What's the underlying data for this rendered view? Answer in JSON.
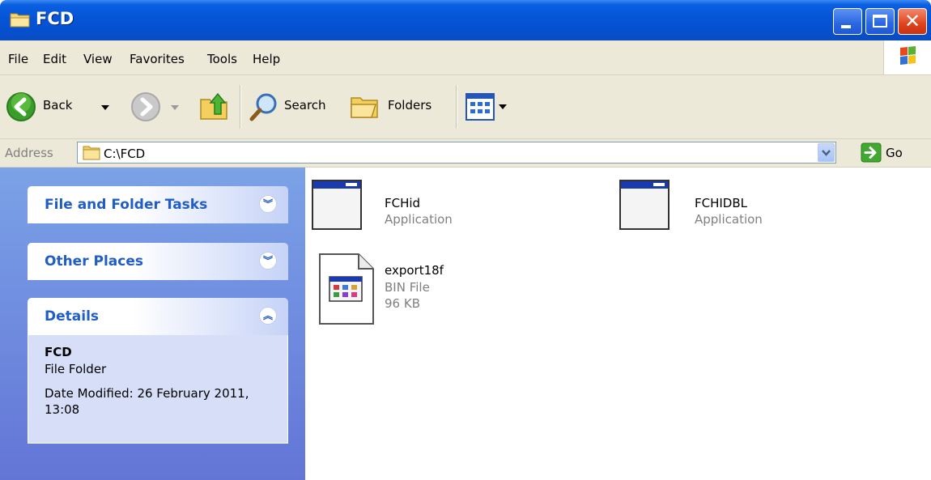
{
  "window": {
    "title": "FCD"
  },
  "menu": [
    "File",
    "Edit",
    "View",
    "Favorites",
    "Tools",
    "Help"
  ],
  "toolbar": {
    "back_label": "Back",
    "search_label": "Search",
    "folders_label": "Folders"
  },
  "address": {
    "label": "Address",
    "path": "C:\\FCD",
    "go_label": "Go"
  },
  "tasks": {
    "file_folder_tasks": "File and Folder Tasks",
    "other_places": "Other Places",
    "details": "Details"
  },
  "details": {
    "name": "FCD",
    "type": "File Folder",
    "modified": "Date Modified: 26 February 2011, 13:08"
  },
  "files": [
    {
      "name": "FCHid",
      "type": "Application",
      "icon": "application-icon"
    },
    {
      "name": "FCHIDBL",
      "type": "Application",
      "icon": "application-icon"
    },
    {
      "name": "export18f",
      "type": "BIN File",
      "size": "96 KB",
      "icon": "bin-file-icon"
    }
  ],
  "colors": {
    "titlebar": "#0554d4",
    "taskpane": "#6d8ee0",
    "task_title": "#215dc6"
  }
}
